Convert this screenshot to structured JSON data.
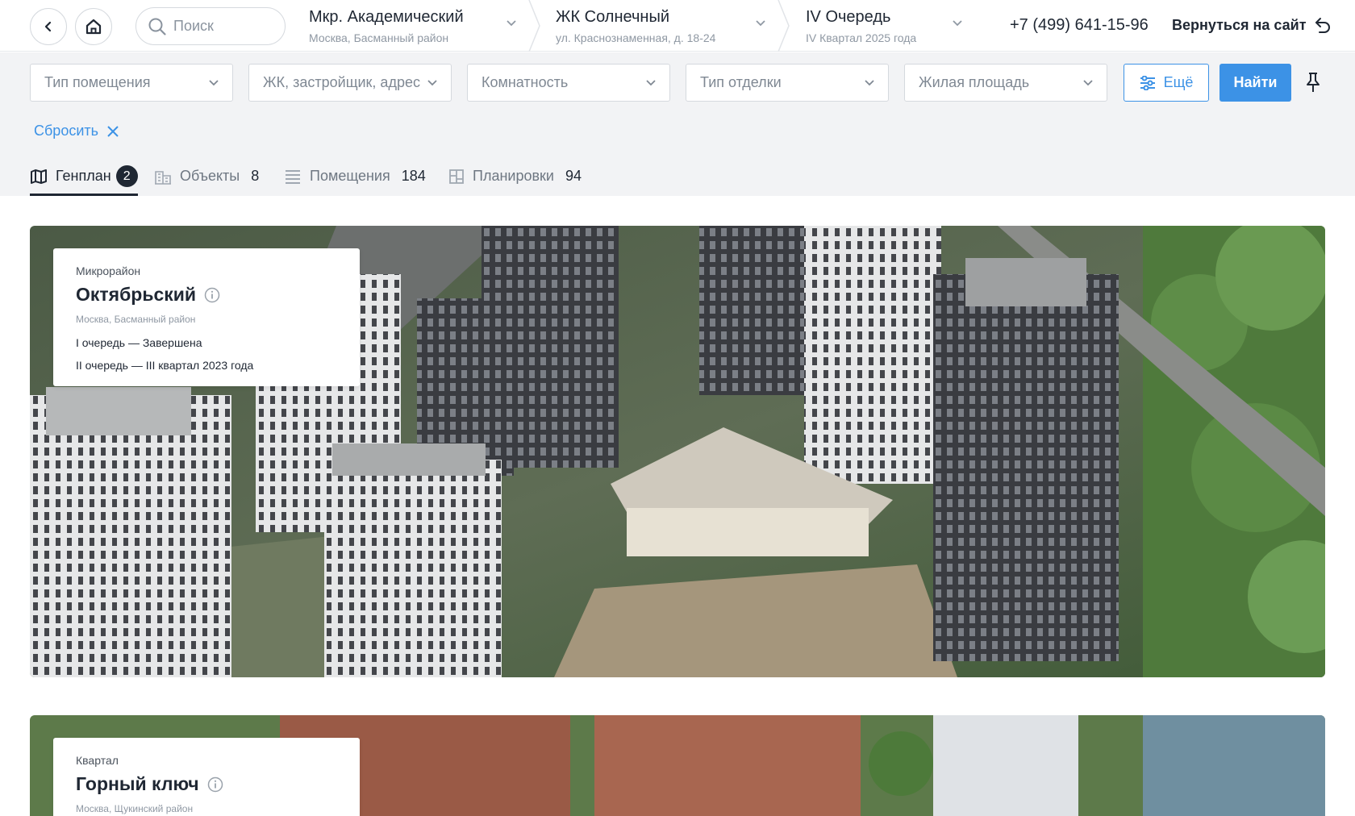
{
  "search": {
    "placeholder": "Поиск"
  },
  "breadcrumbs": [
    {
      "title": "Мкр. Академический",
      "subtitle": "Москва, Басманный район"
    },
    {
      "title": "ЖК Солнечный",
      "subtitle": "ул. Краснознаменная, д. 18-24"
    },
    {
      "title": "IV Очередь",
      "subtitle": "IV Квартал 2025 года"
    }
  ],
  "phone": "+7 (499) 641-15-96",
  "back_to_site": "Вернуться на сайт",
  "filters": {
    "selects": [
      "Тип помещения",
      "ЖК, застройщик, адрес",
      "Комнатность",
      "Тип отделки",
      "Жилая площадь"
    ],
    "more_label": "Ещё",
    "find_label": "Найти",
    "reset_label": "Сбросить"
  },
  "tabs": [
    {
      "label": "Генплан",
      "badge": "2",
      "icon": "map-icon"
    },
    {
      "label": "Объекты",
      "count": "8",
      "icon": "buildings-icon"
    },
    {
      "label": "Помещения",
      "count": "184",
      "icon": "list-icon"
    },
    {
      "label": "Планировки",
      "count": "94",
      "icon": "floorplan-icon"
    }
  ],
  "cards": [
    {
      "type": "Микрорайон",
      "title": "Октябрьский",
      "location": "Москва, Басманный район",
      "lines": [
        "I очередь — Завершена",
        "II очередь — III квартал 2023 года"
      ]
    },
    {
      "type": "Квартал",
      "title": "Горный ключ",
      "location": "Москва, Щукинский район"
    }
  ],
  "colors": {
    "accent": "#3c92e6",
    "dark": "#1f2733",
    "filter_bg": "#f2f3f5"
  }
}
